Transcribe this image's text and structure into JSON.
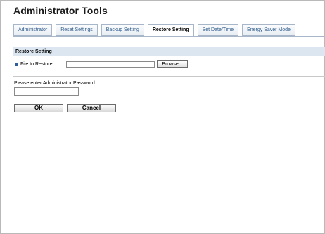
{
  "page": {
    "title": "Administrator Tools"
  },
  "tabs": [
    {
      "label": "Administrator",
      "active": false
    },
    {
      "label": "Reset Settings",
      "active": false
    },
    {
      "label": "Backup Setting",
      "active": false
    },
    {
      "label": "Restore Setting",
      "active": true
    },
    {
      "label": "Set Date/Time",
      "active": false
    },
    {
      "label": "Energy Saver Mode",
      "active": false
    }
  ],
  "restore": {
    "section_title": "Restore Setting",
    "file_label": "File to Restore",
    "file_value": "",
    "browse_label": "Browse..."
  },
  "password": {
    "label": "Please enter Administrator Password.",
    "value": ""
  },
  "buttons": {
    "ok": "OK",
    "cancel": "Cancel"
  },
  "colors": {
    "accent": "#2d5f9c",
    "section_bg": "#dbe6f1",
    "tab_text": "#2e5a8a"
  }
}
